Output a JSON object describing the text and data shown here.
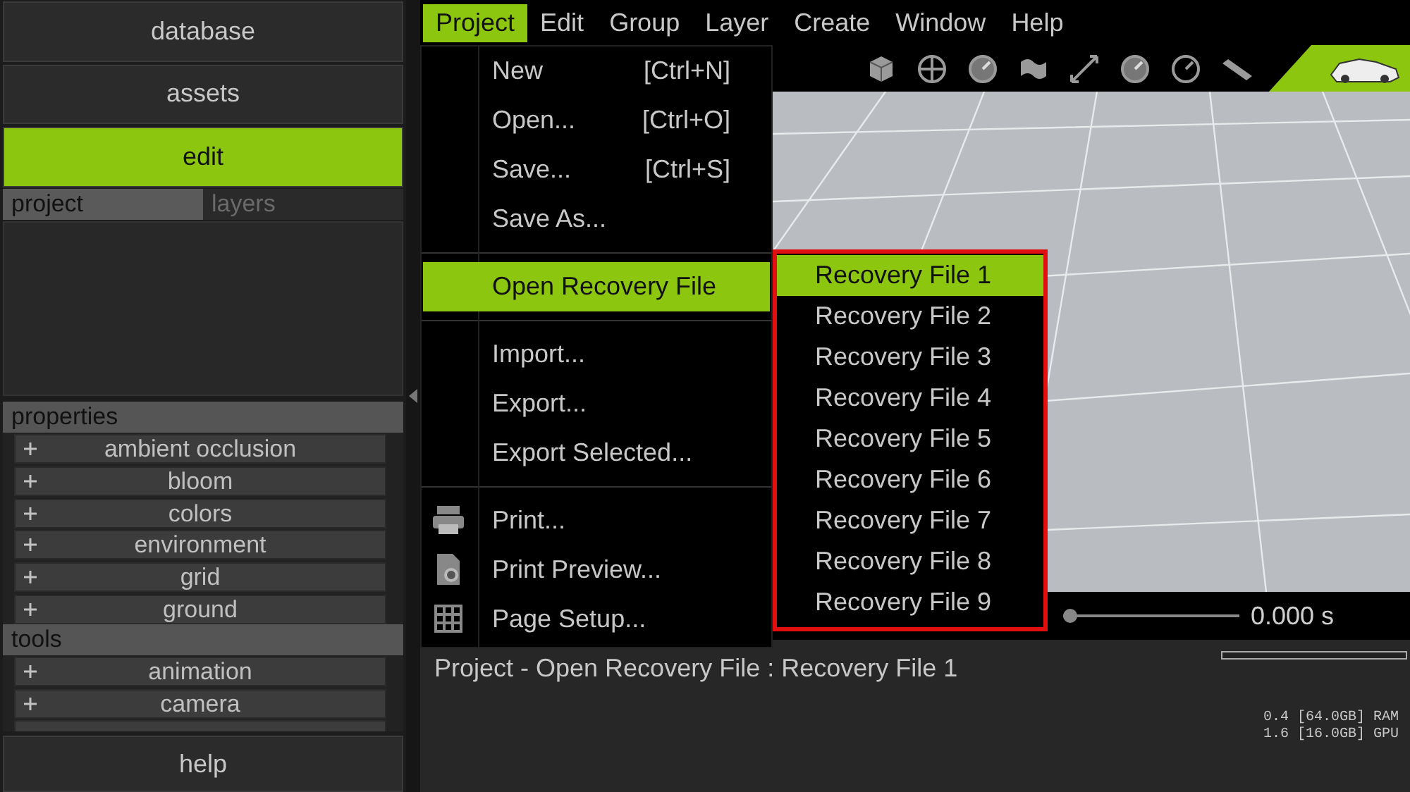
{
  "sidebar": {
    "top_buttons": [
      {
        "label": "database",
        "selected": false
      },
      {
        "label": "assets",
        "selected": false
      },
      {
        "label": "edit",
        "selected": true
      }
    ],
    "tabs": [
      {
        "label": "project",
        "selected": true
      },
      {
        "label": "layers",
        "selected": false
      }
    ],
    "sections": [
      {
        "title": "properties",
        "items": [
          "ambient occlusion",
          "bloom",
          "colors",
          "environment",
          "grid",
          "ground"
        ]
      },
      {
        "title": "tools",
        "items": [
          "animation",
          "camera"
        ]
      }
    ],
    "help": "help"
  },
  "menu_bar": [
    {
      "label": "Project",
      "selected": true
    },
    {
      "label": "Edit",
      "selected": false
    },
    {
      "label": "Group",
      "selected": false
    },
    {
      "label": "Layer",
      "selected": false
    },
    {
      "label": "Create",
      "selected": false
    },
    {
      "label": "Window",
      "selected": false
    },
    {
      "label": "Help",
      "selected": false
    }
  ],
  "project_menu": [
    {
      "kind": "item",
      "label": "New",
      "shortcut": "[Ctrl+N]"
    },
    {
      "kind": "item",
      "label": "Open...",
      "shortcut": "[Ctrl+O]"
    },
    {
      "kind": "item",
      "label": "Save...",
      "shortcut": "[Ctrl+S]"
    },
    {
      "kind": "item",
      "label": "Save As..."
    },
    {
      "kind": "separator"
    },
    {
      "kind": "submenu",
      "label": "Open Recovery File",
      "selected": true
    },
    {
      "kind": "separator"
    },
    {
      "kind": "item",
      "label": "Import..."
    },
    {
      "kind": "item",
      "label": "Export..."
    },
    {
      "kind": "item",
      "label": "Export Selected..."
    },
    {
      "kind": "separator"
    },
    {
      "kind": "icon_item",
      "label": "Print..."
    },
    {
      "kind": "icon_item",
      "label": "Print Preview..."
    },
    {
      "kind": "icon_item",
      "label": "Page Setup..."
    }
  ],
  "recovery_files": [
    {
      "label": "Recovery File 1",
      "selected": true
    },
    {
      "label": "Recovery File 2",
      "selected": false
    },
    {
      "label": "Recovery File 3",
      "selected": false
    },
    {
      "label": "Recovery File 4",
      "selected": false
    },
    {
      "label": "Recovery File 5",
      "selected": false
    },
    {
      "label": "Recovery File 6",
      "selected": false
    },
    {
      "label": "Recovery File 7",
      "selected": false
    },
    {
      "label": "Recovery File 8",
      "selected": false
    },
    {
      "label": "Recovery File 9",
      "selected": false
    }
  ],
  "timeline": {
    "level": 0,
    "reading": "0.000 s"
  },
  "status": {
    "message": "Project - Open Recovery File : Recovery File 1",
    "level": 0,
    "memory": [
      "0.4 [64.0GB] RAM",
      "1.6 [16.0GB] GPU"
    ]
  }
}
